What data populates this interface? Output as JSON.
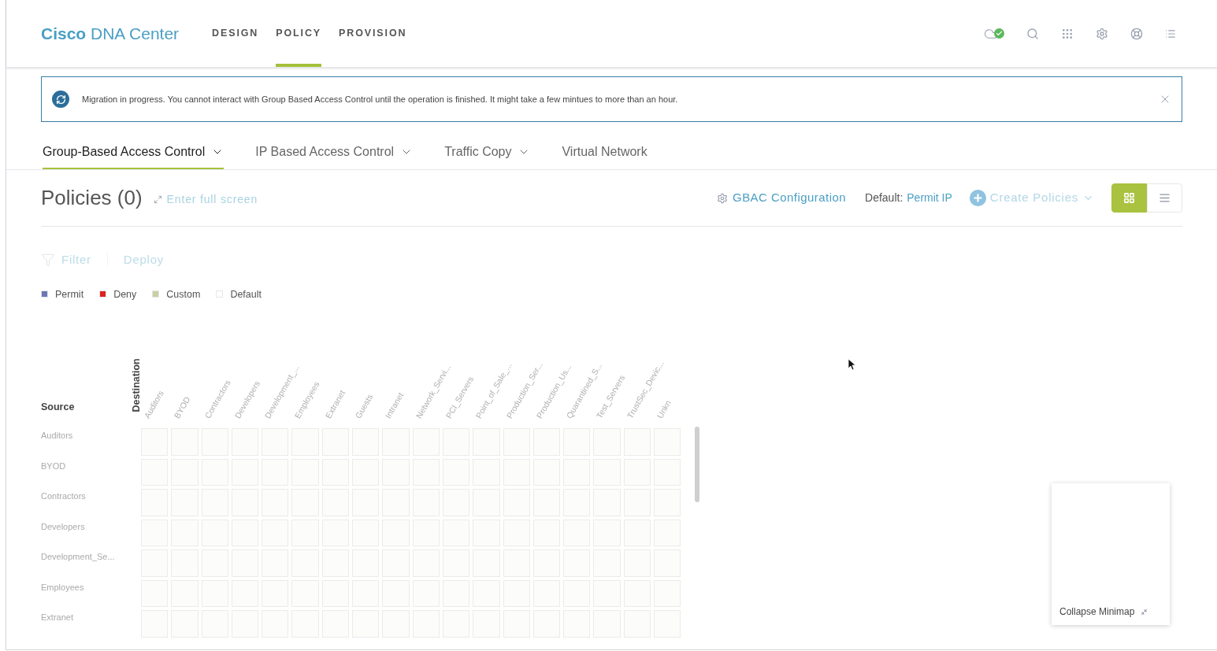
{
  "header": {
    "logo": "**Cisco** DNA Center",
    "nav": [
      {
        "label": "DESIGN",
        "selected": false
      },
      {
        "label": "POLICY",
        "selected": true
      },
      {
        "label": "PROVISION",
        "selected": false
      }
    ]
  },
  "banner": {
    "message": "Migration in progress. You cannot interact with Group Based Access Control until the operation is finished. It might take a few mintues to more than an hour."
  },
  "tabs": [
    {
      "label": "Group-Based Access Control",
      "selected": true,
      "dropdown": true
    },
    {
      "label": "IP Based Access Control",
      "selected": false,
      "dropdown": true
    },
    {
      "label": "Traffic Copy",
      "selected": false,
      "dropdown": true
    },
    {
      "label": "Virtual Network",
      "selected": false,
      "dropdown": false
    }
  ],
  "toolbar": {
    "title": "Policies (0)",
    "fullscreen": "Enter full screen",
    "config": "GBAC Configuration",
    "default_label": "Default:",
    "default_value": "Permit IP",
    "create": "Create Policies",
    "views": [
      {
        "kind": "grid",
        "selected": true
      },
      {
        "kind": "list",
        "selected": false
      }
    ]
  },
  "actions": {
    "filter": "Filter",
    "deploy": "Deploy"
  },
  "legend": [
    {
      "label": "Permit",
      "color": "#6b78b4"
    },
    {
      "label": "Deny",
      "color": "#e02020"
    },
    {
      "label": "Custom",
      "color": "#c9d0a4"
    },
    {
      "label": "Default",
      "color": "#ffffff"
    }
  ],
  "matrix": {
    "destination_label": "Destination",
    "source_label": "Source",
    "destinations": [
      "Auditors",
      "BYOD",
      "Contractors",
      "Developers",
      "Development_...",
      "Employees",
      "Extranet",
      "Guests",
      "Intranet",
      "Network_Servi...",
      "PCI_Servers",
      "Point_of_Sale_...",
      "Production_Ser...",
      "Production_Us...",
      "Quarantined_S...",
      "Test_Servers",
      "TrustSec_Devic...",
      "Unkn"
    ],
    "sources": [
      "Auditors",
      "BYOD",
      "Contractors",
      "Developers",
      "Development_Se...",
      "Employees",
      "Extranet"
    ]
  },
  "minimap": {
    "collapse": "Collapse Minimap"
  }
}
